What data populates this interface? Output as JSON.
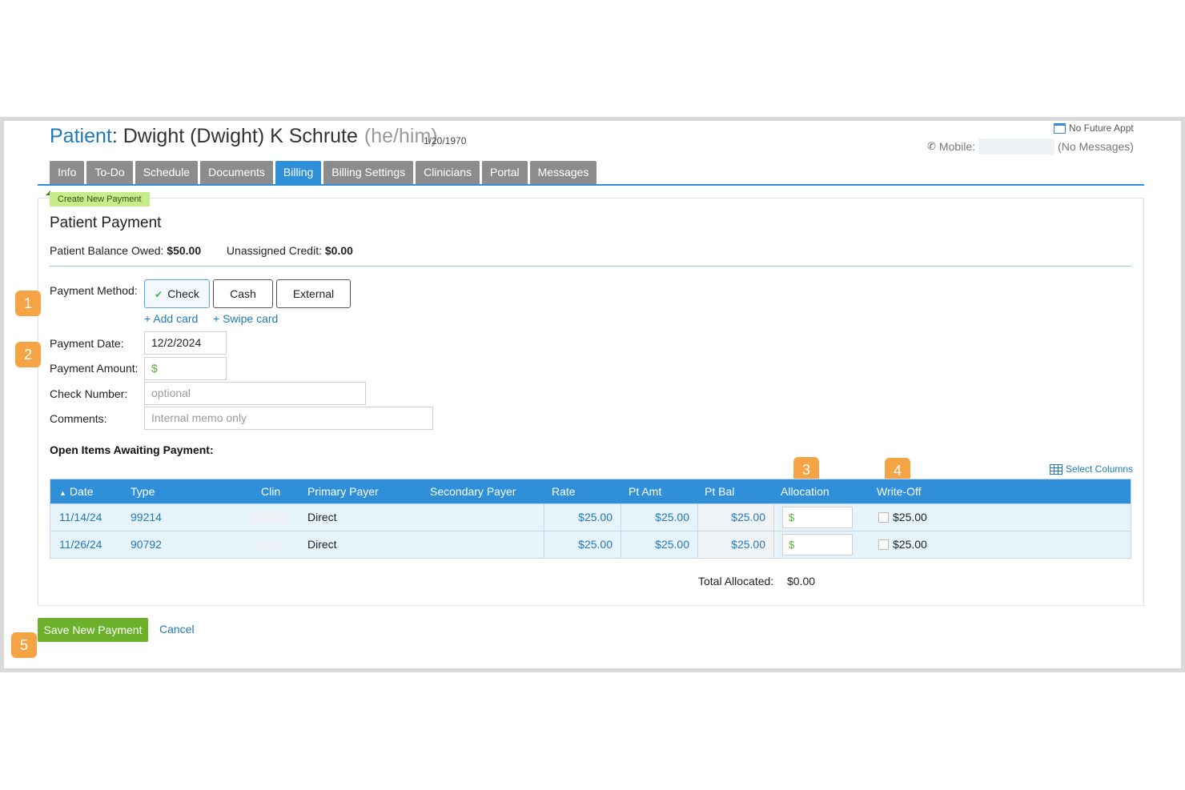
{
  "header": {
    "patient_label": "Patient",
    "patient_name": "Dwight (Dwight) K Schrute",
    "pronouns": "(he/him)",
    "dob": "1/20/1970",
    "appt_status": "No Future Appt",
    "mobile_label": "Mobile:",
    "messages": "(No Messages)"
  },
  "tabs": [
    {
      "label": "Info"
    },
    {
      "label": "To-Do"
    },
    {
      "label": "Schedule"
    },
    {
      "label": "Documents"
    },
    {
      "label": "Billing",
      "active": true
    },
    {
      "label": "Billing Settings"
    },
    {
      "label": "Clinicians"
    },
    {
      "label": "Portal"
    },
    {
      "label": "Messages"
    }
  ],
  "panel": {
    "breadcrumb": "Create New Payment",
    "title": "Patient Payment",
    "balance_label": "Patient Balance Owed:",
    "balance_value": "$50.00",
    "credit_label": "Unassigned Credit:",
    "credit_value": "$0.00"
  },
  "callouts": [
    "1",
    "2",
    "3",
    "4",
    "5"
  ],
  "form": {
    "method_label": "Payment Method:",
    "methods": [
      "Check",
      "Cash",
      "External"
    ],
    "selected_method": "Check",
    "add_card": "+ Add card",
    "swipe_card": "+ Swipe card",
    "date_label": "Payment Date:",
    "date_value": "12/2/2024",
    "amount_label": "Payment Amount:",
    "amount_prefix": "$",
    "check_label": "Check Number:",
    "check_placeholder": "optional",
    "comments_label": "Comments:",
    "comments_placeholder": "Internal memo only"
  },
  "open_items": {
    "title": "Open Items Awaiting Payment:",
    "select_columns": "Select Columns",
    "columns": {
      "date": "Date",
      "type": "Type",
      "clin": "Clin",
      "primary": "Primary Payer",
      "secondary": "Secondary Payer",
      "rate": "Rate",
      "pt_amt": "Pt Amt",
      "pt_bal": "Pt Bal",
      "allocation": "Allocation",
      "write_off": "Write-Off"
    },
    "sort_indicator": "▲",
    "rows": [
      {
        "date": "11/14/24",
        "type": "99214",
        "primary": "Direct",
        "rate": "$25.00",
        "pt_amt": "$25.00",
        "pt_bal": "$25.00",
        "alloc_prefix": "$",
        "write_off": "$25.00"
      },
      {
        "date": "11/26/24",
        "type": "90792",
        "primary": "Direct",
        "rate": "$25.00",
        "pt_amt": "$25.00",
        "pt_bal": "$25.00",
        "alloc_prefix": "$",
        "write_off": "$25.00"
      }
    ],
    "total_label": "Total Allocated:",
    "total_value": "$0.00"
  },
  "actions": {
    "save": "Save New Payment",
    "cancel": "Cancel"
  },
  "colors": {
    "accent": "#2f8fd8",
    "callout": "#f5a445",
    "save": "#6cb02c",
    "breadcrumb": "#c8ec8a"
  }
}
